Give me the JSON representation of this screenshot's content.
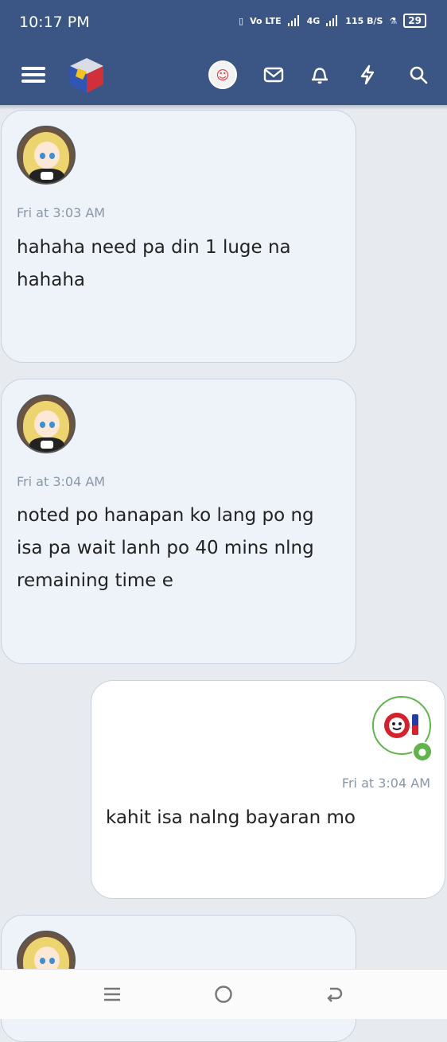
{
  "status_bar": {
    "time": "10:17 PM",
    "net_label": "Vo LTE",
    "net_4g": "4G",
    "speed": "115 B/S",
    "battery": "29"
  },
  "app_bar": {
    "icons": [
      "menu-icon",
      "app-logo",
      "user-avatar",
      "mail-icon",
      "bell-icon",
      "bolt-icon",
      "search-icon"
    ]
  },
  "messages": [
    {
      "side": "other",
      "time": "Fri at 3:03 AM",
      "lines": [
        "hahaha need pa din 1 luge na",
        "hahaha"
      ]
    },
    {
      "side": "other",
      "time": "Fri at 3:04 AM",
      "lines": [
        "noted po hanapan ko lang po ng",
        "isa pa wait lanh po 40 mins nlng",
        "remaining time e"
      ]
    },
    {
      "side": "mine",
      "time": "Fri at 3:04 AM",
      "lines": [
        "kahit isa nalng bayaran mo"
      ]
    }
  ],
  "nav_bar": {
    "icons": [
      "recent-apps-icon",
      "home-icon",
      "back-icon"
    ]
  }
}
